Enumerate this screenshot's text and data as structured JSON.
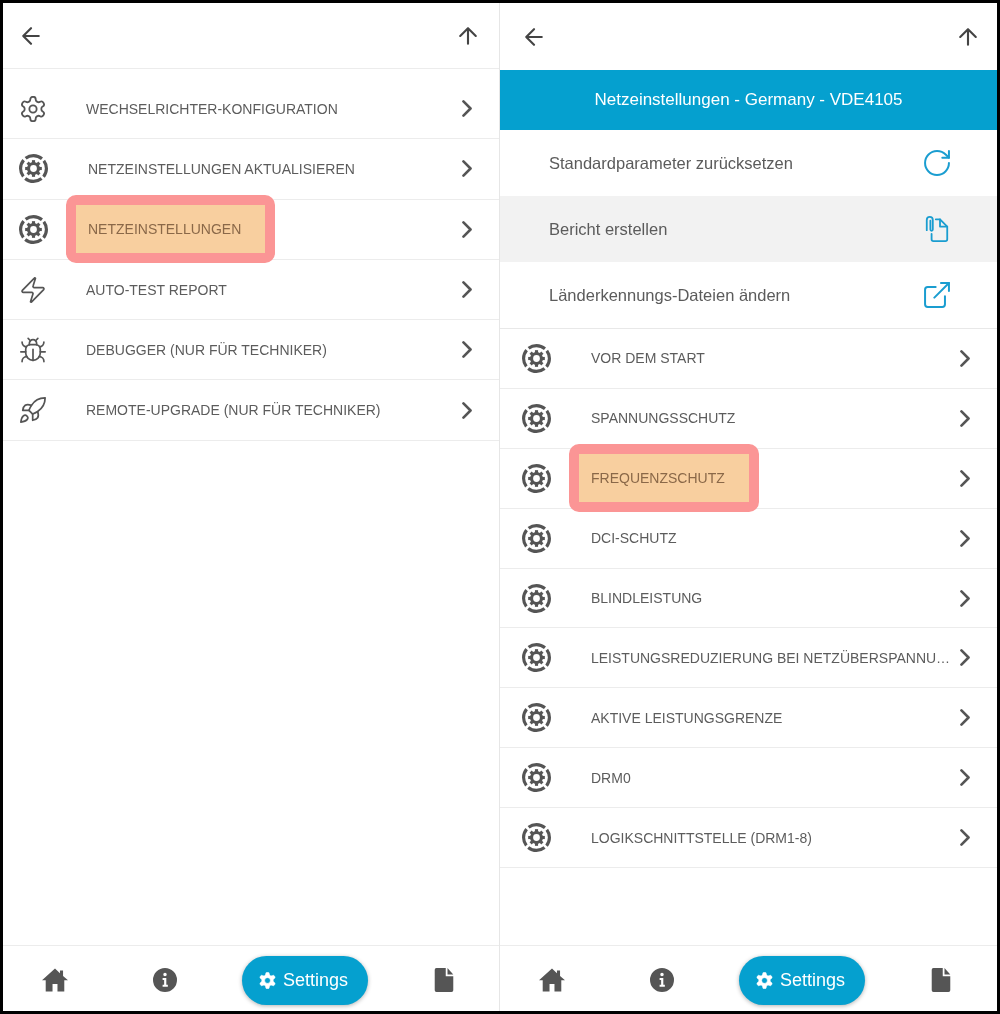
{
  "panels": [
    {
      "menu": [
        {
          "kind": "gear",
          "label": "WECHSELRICHTER-KONFIGURATION",
          "highlighted": false
        },
        {
          "kind": "gear-ring",
          "label": "NETZEINSTELLUNGEN AKTUALISIEREN",
          "highlighted": false
        },
        {
          "kind": "gear-ring",
          "label": "NETZEINSTELLUNGEN",
          "highlighted": true
        },
        {
          "kind": "bolt",
          "label": "AUTO-TEST REPORT",
          "highlighted": false
        },
        {
          "kind": "bug",
          "label": "DEBUGGER (NUR FÜR TECHNIKER)",
          "highlighted": false
        },
        {
          "kind": "rocket",
          "label": "REMOTE-UPGRADE (NUR FÜR TECHNIKER)",
          "highlighted": false
        }
      ],
      "nav": [
        {
          "kind": "home",
          "selected": false
        },
        {
          "kind": "info",
          "selected": false
        },
        {
          "kind": "settings",
          "label": "Settings",
          "selected": true
        },
        {
          "kind": "document",
          "selected": false
        }
      ]
    },
    {
      "banner": "Netzeinstellungen - Germany - VDE4105",
      "actions": [
        {
          "kind": "reset",
          "label": "Standardparameter zurücksetzen",
          "selected": false
        },
        {
          "kind": "report",
          "label": "Bericht erstellen",
          "selected": true
        },
        {
          "kind": "external-link",
          "label": "Länderkennungs-Dateien ändern",
          "selected": false
        }
      ],
      "menu": [
        {
          "kind": "gear-ring",
          "label": "VOR DEM START",
          "highlighted": false
        },
        {
          "kind": "gear-ring",
          "label": "SPANNUNGSSCHUTZ",
          "highlighted": false
        },
        {
          "kind": "gear-ring",
          "label": "FREQUENZSCHUTZ",
          "highlighted": true
        },
        {
          "kind": "gear-ring",
          "label": "DCI-SCHUTZ",
          "highlighted": false
        },
        {
          "kind": "gear-ring",
          "label": "BLINDLEISTUNG",
          "highlighted": false
        },
        {
          "kind": "gear-ring",
          "label": "LEISTUNGSREDUZIERUNG BEI NETZÜBERSPANNU…",
          "highlighted": false
        },
        {
          "kind": "gear-ring",
          "label": "AKTIVE LEISTUNGSGRENZE",
          "highlighted": false
        },
        {
          "kind": "gear-ring",
          "label": "DRM0",
          "highlighted": false
        },
        {
          "kind": "gear-ring",
          "label": "LOGIKSCHNITTSTELLE (DRM1-8)",
          "highlighted": false
        }
      ],
      "nav": [
        {
          "kind": "home",
          "selected": false
        },
        {
          "kind": "info",
          "selected": false
        },
        {
          "kind": "settings",
          "label": "Settings",
          "selected": true
        },
        {
          "kind": "document",
          "selected": false
        }
      ]
    }
  ]
}
